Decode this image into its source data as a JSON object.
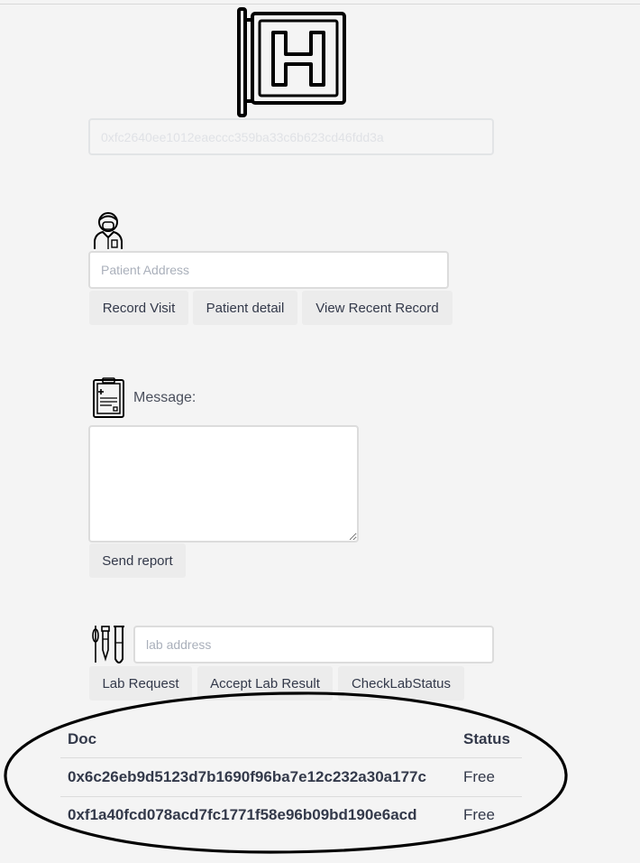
{
  "account": {
    "address": "0xfc2640ee1012eaeccc359ba33c6b623cd46fdd3a"
  },
  "patient": {
    "placeholder": "Patient Address",
    "buttons": {
      "record_visit": "Record Visit",
      "patient_detail": "Patient detail",
      "view_recent": "View Recent Record"
    }
  },
  "report": {
    "message_label": "Message:",
    "send_label": "Send report"
  },
  "lab": {
    "placeholder": "lab address",
    "buttons": {
      "lab_request": "Lab Request",
      "accept_result": "Accept Lab Result",
      "check_status": "CheckLabStatus"
    }
  },
  "docs_table": {
    "headers": {
      "doc": "Doc",
      "status": "Status"
    },
    "rows": [
      {
        "doc": "0x6c26eb9d5123d7b1690f96ba7e12c232a30a177c",
        "status": "Free"
      },
      {
        "doc": "0xf1a40fcd078acd7fc1771f58e96b09bd190e6acd",
        "status": "Free"
      }
    ]
  }
}
